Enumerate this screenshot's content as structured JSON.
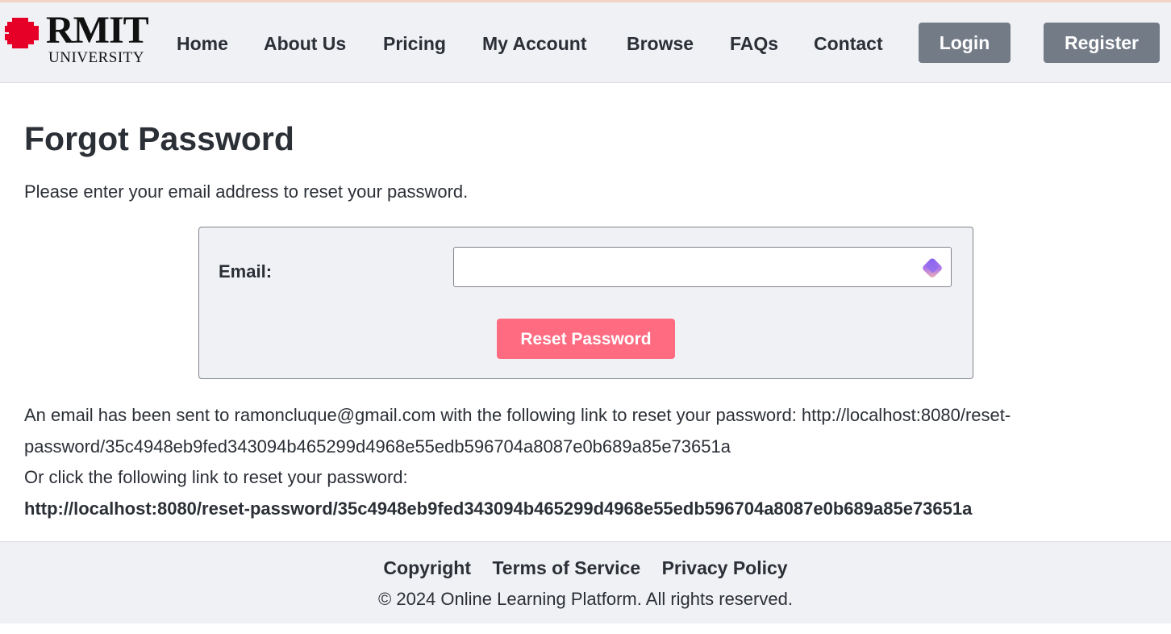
{
  "header": {
    "logo": {
      "word": "RMIT",
      "sub": "UNIVERSITY",
      "icon": "pixel-shield-icon",
      "color": "#e60028"
    },
    "nav": [
      {
        "label": "Home"
      },
      {
        "label": "About Us"
      },
      {
        "label": "Pricing"
      },
      {
        "label": "My Account"
      },
      {
        "label": "Browse"
      },
      {
        "label": "FAQs"
      },
      {
        "label": "Contact"
      }
    ],
    "login_label": "Login",
    "register_label": "Register"
  },
  "main": {
    "title": "Forgot Password",
    "intro": "Please enter your email address to reset your password.",
    "form": {
      "email_label": "Email:",
      "email_value": "",
      "reset_label": "Reset Password"
    },
    "message": {
      "sent_text": "An email has been sent to ramoncluque@gmail.com with the following link to reset your password: http://localhost:8080/reset-password/35c4948eb9fed343094b465299d4968e55edb596704a8087e0b689a85e73651a",
      "click_text": "Or click the following link to reset your password:",
      "link": "http://localhost:8080/reset-password/35c4948eb9fed343094b465299d4968e55edb596704a8087e0b689a85e73651a"
    }
  },
  "footer": {
    "links": [
      {
        "label": "Copyright"
      },
      {
        "label": "Terms of Service"
      },
      {
        "label": "Privacy Policy"
      }
    ],
    "copyright": "© 2024 Online Learning Platform. All rights reserved."
  },
  "colors": {
    "header_bg": "#f0f1f5",
    "nav_button": "#737b87",
    "reset_button": "#ff6b81",
    "text": "#2b2f36"
  }
}
